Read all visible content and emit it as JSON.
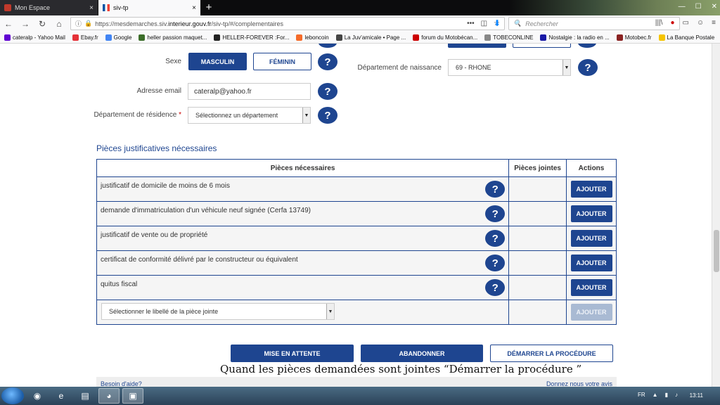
{
  "browser": {
    "tabs": [
      {
        "label": "Mon Espace",
        "close": "×"
      },
      {
        "label": "siv-tp",
        "close": "×"
      }
    ],
    "new_tab": "+",
    "window_controls": [
      "—",
      "☐",
      "✕"
    ],
    "url_prefix": "https://mesdemarches.siv.",
    "url_domain": "interieur.gouv.fr",
    "url_suffix": "/siv-tp/#/complementaires",
    "search_placeholder": "Rechercher",
    "bookmarks": [
      {
        "label": "cateralp - Yahoo Mail",
        "color": "#6001d2"
      },
      {
        "label": "Ebay.fr",
        "color": "#e53238"
      },
      {
        "label": "Google",
        "color": "#4285f4"
      },
      {
        "label": "heller passion maquet...",
        "color": "#3c6e2a"
      },
      {
        "label": "HELLER-FOREVER :For...",
        "color": "#222222"
      },
      {
        "label": "leboncoin",
        "color": "#f56b2a"
      },
      {
        "label": "La Juv'amicale • Page ...",
        "color": "#444444"
      },
      {
        "label": "forum du Motobécan...",
        "color": "#cc0000"
      },
      {
        "label": "TOBECONLINE",
        "color": "#888888"
      },
      {
        "label": "Nostalgie : la radio en ...",
        "color": "#1a1aa6"
      },
      {
        "label": "Motobec.fr",
        "color": "#8a2222"
      },
      {
        "label": "La Banque Postale",
        "color": "#f5c400"
      }
    ]
  },
  "form": {
    "sexe_label": "Sexe",
    "sexe_options": [
      "MASCULIN",
      "FÉMININ"
    ],
    "email_label": "Adresse email",
    "email_value": "cateralp@yahoo.fr",
    "residence_label": "Département de résidence",
    "residence_required": "*",
    "residence_value": "Sélectionnez un département",
    "naissance_label": "Département de naissance",
    "naissance_value": "69 - RHONE",
    "help": "?"
  },
  "pieces": {
    "title": "Pièces justificatives nécessaires",
    "headers": [
      "Pièces nécessaires",
      "Pièces jointes",
      "Actions"
    ],
    "rows": [
      "justificatif de domicile de moins de 6 mois",
      "demande d'immatriculation d'un véhicule neuf signée (Cerfa 13749)",
      "justificatif de vente ou de propriété",
      "certificat de conformité délivré par le constructeur ou équivalent",
      "quitus fiscal"
    ],
    "add_label": "AJOUTER",
    "select_placeholder": "Sélectionner le libellé de la pièce jointe"
  },
  "actions": {
    "save": "MISE EN ATTENTE",
    "abandon": "ABANDONNER",
    "start": "DÉMARRER LA PROCÉDURE"
  },
  "caption": "Quand les pièces demandées sont jointes “Démarrer la procédure ”",
  "footer": {
    "help": "Besoin d'aide?",
    "feedback": "Donnez nous votre avis"
  },
  "taskbar": {
    "lang": "FR",
    "time": "13:11"
  },
  "colors": {
    "primary": "#1e4590",
    "disabled": "#a9bad3"
  }
}
